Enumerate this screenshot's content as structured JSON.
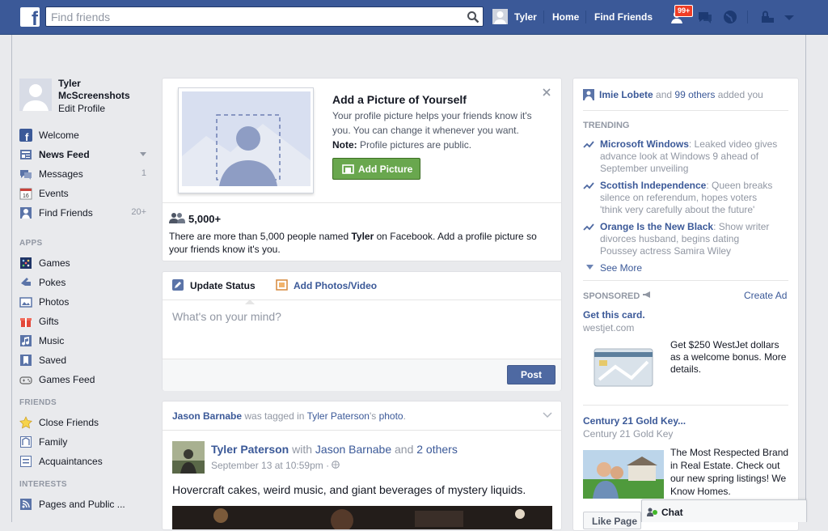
{
  "topbar": {
    "logo": "f",
    "search_placeholder": "Find friends",
    "user_name": "Tyler",
    "home": "Home",
    "find_friends": "Find Friends",
    "friend_requests_badge": "99+",
    "icons": [
      "friend-requests-icon",
      "messages-icon",
      "notifications-icon",
      "privacy-icon",
      "account-menu-icon"
    ]
  },
  "profile": {
    "first": "Tyler",
    "last": "McScreenshots",
    "edit": "Edit Profile"
  },
  "nav_main": [
    {
      "label": "Welcome",
      "count": ""
    },
    {
      "label": "News Feed",
      "count": ""
    },
    {
      "label": "Messages",
      "count": "1"
    },
    {
      "label": "Events",
      "count": ""
    },
    {
      "label": "Find Friends",
      "count": "20+"
    }
  ],
  "apps_header": "APPS",
  "apps": [
    "Games",
    "Pokes",
    "Photos",
    "Gifts",
    "Music",
    "Saved",
    "Games Feed"
  ],
  "friends_header": "FRIENDS",
  "friends": [
    "Close Friends",
    "Family",
    "Acquaintances"
  ],
  "interests_header": "INTERESTS",
  "interests": [
    "Pages and Public ..."
  ],
  "picture_prompt": {
    "title": "Add a Picture of Yourself",
    "text": "Your profile picture helps your friends know it's you. You can change it whenever you want.",
    "note_label": "Note:",
    "note_text": " Profile pictures are public.",
    "button": "Add Picture",
    "count": "5,000+",
    "desc_pre": "There are more than 5,000 people named ",
    "desc_name": "Tyler",
    "desc_post": " on Facebook. Add a profile picture so your friends know it's you."
  },
  "composer": {
    "update_status": "Update Status",
    "add_photos": "Add Photos/Video",
    "placeholder": "What's on your mind?",
    "post": "Post"
  },
  "story": {
    "tag_actor": "Jason Barnabe",
    "tag_mid": " was tagged in ",
    "tag_target": "Tyler Paterson",
    "tag_poss": "'s ",
    "tag_obj": "photo",
    "tag_end": ".",
    "author": "Tyler Paterson",
    "with": " with ",
    "with_name": "Jason Barnabe",
    "and": " and ",
    "others": "2 others",
    "time": "September 13 at 10:59pm · ",
    "text": "Hovercraft cakes, weird music, and giant beverages of mystery liquids."
  },
  "right": {
    "added_name": "Imie Lobete",
    "added_and": " and ",
    "added_others": "99 others",
    "added_tail": " added you",
    "trending_header": "TRENDING",
    "trending": [
      {
        "title": "Microsoft Windows",
        "text": ": Leaked video gives advance look at Windows 9 ahead of September unveiling"
      },
      {
        "title": "Scottish Independence",
        "text": ": Queen breaks silence on referendum, hopes voters 'think very carefully about the future'"
      },
      {
        "title": "Orange Is the New Black",
        "text": ": Show writer divorces husband, begins dating Poussey actress Samira Wiley"
      }
    ],
    "see_more": "See More",
    "sponsored": "SPONSORED",
    "create_ad": "Create Ad",
    "ad1_title": "Get this card.",
    "ad1_domain": "westjet.com",
    "ad1_text": "Get $250 WestJet dollars as a welcome bonus. More details.",
    "ad2_title": "Century 21 Gold Key...",
    "ad2_domain": "Century 21 Gold Key",
    "ad2_text": "The Most Respected Brand in Real Estate. Check out our new spring listings! We Know Homes.",
    "like_page": "Like Page",
    "chat": "Chat"
  }
}
